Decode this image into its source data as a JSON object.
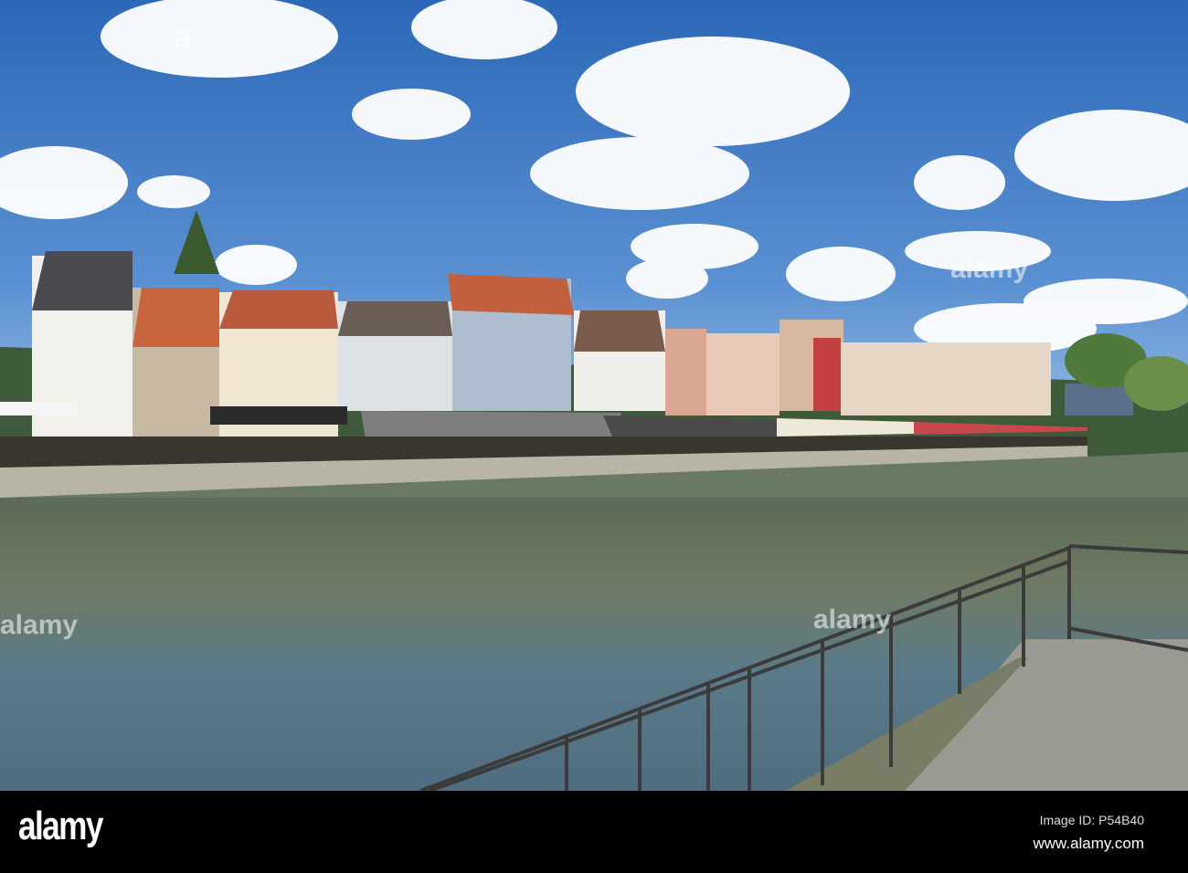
{
  "watermark": {
    "logo": "alamy",
    "image_id": "Image ID: P54B40",
    "url": "www.alamy.com"
  },
  "colors": {
    "sky_top": "#2f6fbf",
    "sky_bottom": "#8cb6e0",
    "water": "#4e5a45",
    "bar": "#000000"
  }
}
